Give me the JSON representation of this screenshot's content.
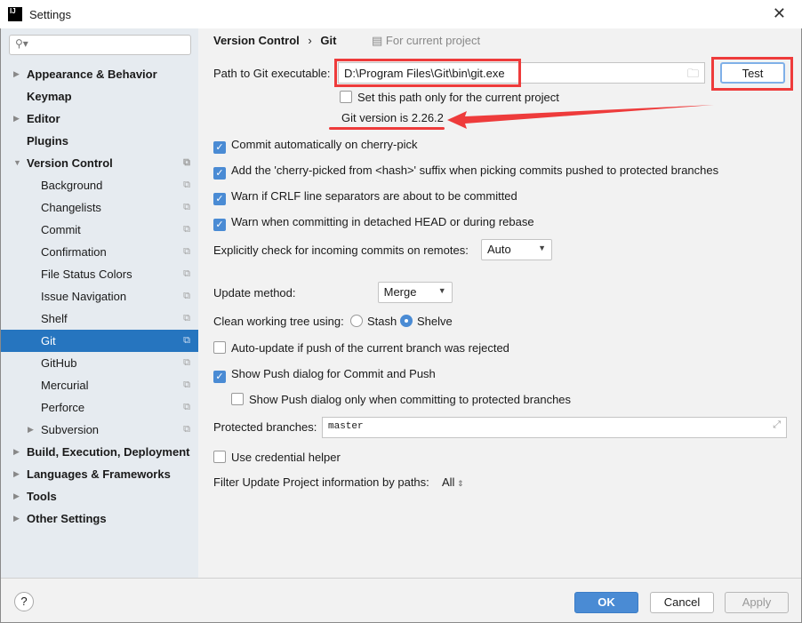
{
  "window": {
    "title": "Settings",
    "logo": "IJ"
  },
  "sidebar": {
    "search_placeholder": "",
    "items": [
      {
        "label": "Appearance & Behavior",
        "bold": true,
        "arrow": "right"
      },
      {
        "label": "Keymap",
        "bold": true
      },
      {
        "label": "Editor",
        "bold": true,
        "arrow": "right"
      },
      {
        "label": "Plugins",
        "bold": true
      },
      {
        "label": "Version Control",
        "bold": true,
        "arrow": "down",
        "copy": true
      },
      {
        "label": "Background",
        "copy": true
      },
      {
        "label": "Changelists",
        "copy": true
      },
      {
        "label": "Commit",
        "copy": true
      },
      {
        "label": "Confirmation",
        "copy": true
      },
      {
        "label": "File Status Colors",
        "copy": true
      },
      {
        "label": "Issue Navigation",
        "copy": true
      },
      {
        "label": "Shelf",
        "copy": true
      },
      {
        "label": "Git",
        "copy": true,
        "selected": true
      },
      {
        "label": "GitHub",
        "copy": true
      },
      {
        "label": "Mercurial",
        "copy": true
      },
      {
        "label": "Perforce",
        "copy": true
      },
      {
        "label": "Subversion",
        "copy": true,
        "arrow": "right"
      },
      {
        "label": "Build, Execution, Deployment",
        "bold": true,
        "arrow": "right"
      },
      {
        "label": "Languages & Frameworks",
        "bold": true,
        "arrow": "right"
      },
      {
        "label": "Tools",
        "bold": true,
        "arrow": "right"
      },
      {
        "label": "Other Settings",
        "bold": true,
        "arrow": "right"
      }
    ]
  },
  "breadcrumb": {
    "parent": "Version Control",
    "sep": "›",
    "current": "Git",
    "scope": "For current project"
  },
  "git": {
    "path_label": "Path to Git executable:",
    "path_value": "D:\\Program Files\\Git\\bin\\git.exe",
    "test_label": "Test",
    "set_path_only": "Set this path only for the current project",
    "version": "Git version is 2.26.2",
    "cherry_pick": "Commit automatically on cherry-pick",
    "cherry_suffix": "Add the 'cherry-picked from <hash>' suffix when picking commits pushed to protected branches",
    "warn_crlf": "Warn if CRLF line separators are about to be committed",
    "warn_detached": "Warn when committing in detached HEAD or during rebase",
    "incoming_label": "Explicitly check for incoming commits on remotes:",
    "incoming_value": "Auto",
    "update_label": "Update method:",
    "update_value": "Merge",
    "clean_label": "Clean working tree using:",
    "stash": "Stash",
    "shelve": "Shelve",
    "auto_update": "Auto-update if push of the current branch was rejected",
    "show_push": "Show Push dialog for Commit and Push",
    "show_push_protected": "Show Push dialog only when committing to protected branches",
    "protected_label": "Protected branches:",
    "protected_value": "master",
    "credential": "Use credential helper",
    "filter_label": "Filter Update Project information by paths:",
    "filter_value": "All"
  },
  "footer": {
    "help": "?",
    "ok": "OK",
    "cancel": "Cancel",
    "apply": "Apply"
  },
  "colors": {
    "accent": "#2675bf",
    "annotation": "#ee3b3b",
    "ok_button": "#4a8bd4"
  }
}
